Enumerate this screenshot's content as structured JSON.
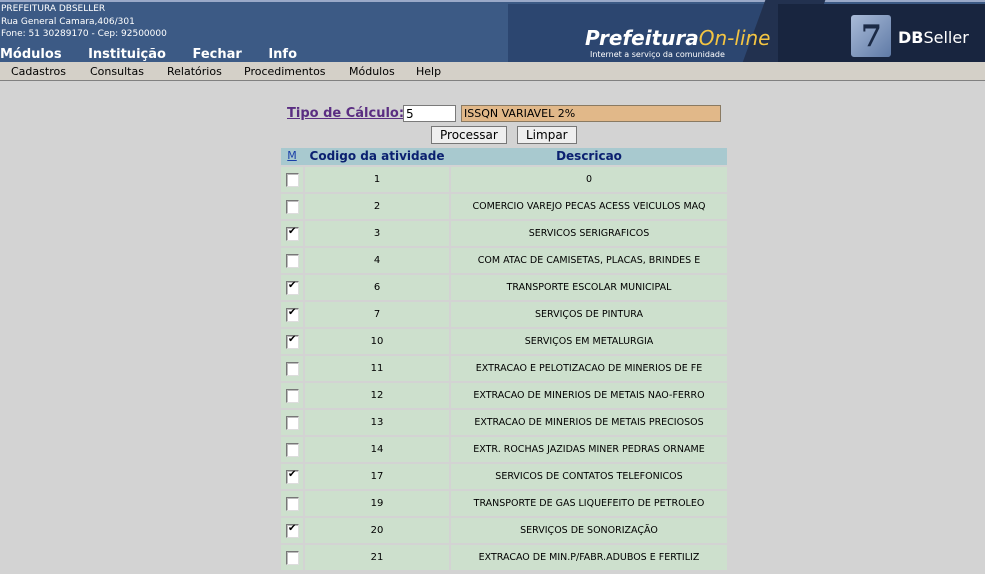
{
  "header": {
    "org_name": "PREFEITURA DBSELLER",
    "address": "Rua General Camara,406/301",
    "contact": "Fone: 51 30289170  -  Cep: 92500000",
    "top_menu": [
      "Módulos",
      "Instituição",
      "Fechar",
      "Info"
    ],
    "banner_title_bold": "Prefeitura",
    "banner_title_script": "On-line",
    "banner_subtitle": "Internet a serviço da comunidade",
    "brand_bold": "DB",
    "brand_light": "Seller"
  },
  "menubar": [
    "Cadastros",
    "Consultas",
    "Relatórios",
    "Procedimentos",
    "Módulos",
    "Help"
  ],
  "form": {
    "tipo_label": "Tipo de Cálculo:",
    "tipo_code": "5",
    "tipo_desc": "ISSQN VARIAVEL 2%",
    "process_button": "Processar",
    "clear_button": "Limpar"
  },
  "table": {
    "headers": {
      "mark": "M",
      "code": "Codigo da atividade",
      "desc": "Descricao"
    },
    "rows": [
      {
        "code": "1",
        "desc": "0",
        "checked": false
      },
      {
        "code": "2",
        "desc": "COMERCIO VAREJO PECAS ACESS VEICULOS MAQ",
        "checked": false
      },
      {
        "code": "3",
        "desc": "SERVICOS SERIGRAFICOS",
        "checked": true
      },
      {
        "code": "4",
        "desc": "COM ATAC DE CAMISETAS, PLACAS, BRINDES E",
        "checked": false
      },
      {
        "code": "6",
        "desc": "TRANSPORTE ESCOLAR MUNICIPAL",
        "checked": true
      },
      {
        "code": "7",
        "desc": "SERVIÇOS DE PINTURA",
        "checked": true
      },
      {
        "code": "10",
        "desc": "SERVIÇOS EM METALURGIA",
        "checked": true
      },
      {
        "code": "11",
        "desc": "EXTRACAO E PELOTIZACAO DE MINERIOS DE FE",
        "checked": false
      },
      {
        "code": "12",
        "desc": "EXTRACAO DE MINERIOS DE METAIS NAO-FERRO",
        "checked": false
      },
      {
        "code": "13",
        "desc": "EXTRACAO DE MINERIOS DE METAIS PRECIOSOS",
        "checked": false
      },
      {
        "code": "14",
        "desc": "EXTR. ROCHAS JAZIDAS MINER PEDRAS ORNAME",
        "checked": false
      },
      {
        "code": "17",
        "desc": "SERVICOS DE CONTATOS TELEFONICOS",
        "checked": true
      },
      {
        "code": "19",
        "desc": "TRANSPORTE DE GAS LIQUEFEITO DE PETROLEO",
        "checked": false
      },
      {
        "code": "20",
        "desc": "SERVIÇOS DE SONORIZAÇÃO",
        "checked": true
      },
      {
        "code": "21",
        "desc": "EXTRACAO DE MIN.P/FABR.ADUBOS E FERTILIZ",
        "checked": false
      }
    ]
  }
}
